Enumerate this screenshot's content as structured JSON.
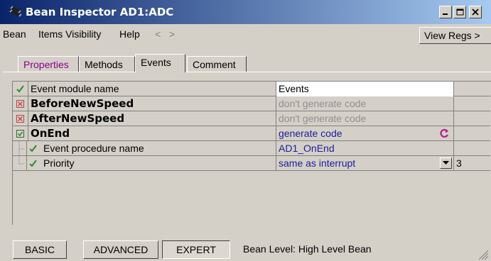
{
  "window": {
    "title": "Bean Inspector AD1:ADC",
    "icon": "bean-chip-icon",
    "controls": [
      "minimize-icon",
      "maximize-icon",
      "close-icon"
    ]
  },
  "menu": {
    "items": [
      "Bean",
      "Items Visibility",
      "Help"
    ],
    "back": "<",
    "forward": ">",
    "view_regs": "View Regs >"
  },
  "tabs": [
    {
      "label": "Properties",
      "active": false
    },
    {
      "label": "Methods",
      "active": false
    },
    {
      "label": "Events",
      "active": true
    },
    {
      "label": "Comment",
      "active": false
    }
  ],
  "rows": [
    {
      "check": "check",
      "name": "Event module name",
      "bold": false,
      "indent": 0,
      "value": "Events",
      "value_style": "white"
    },
    {
      "check": "disabled",
      "name": "BeforeNewSpeed",
      "bold": true,
      "indent": 0,
      "value": "don't generate code",
      "value_style": "gray"
    },
    {
      "check": "disabled",
      "name": "AfterNewSpeed",
      "bold": true,
      "indent": 0,
      "value": "don't generate code",
      "value_style": "gray"
    },
    {
      "check": "enabled",
      "name": "OnEnd",
      "bold": true,
      "indent": 0,
      "value": "generate code",
      "value_style": "blue"
    },
    {
      "check": "check",
      "name": "Event procedure name",
      "bold": false,
      "indent": 1,
      "value": "AD1_OnEnd",
      "value_style": "blue"
    },
    {
      "check": "check",
      "name": "Priority",
      "bold": false,
      "indent": 1,
      "value": "same as interrupt",
      "value_style": "blue",
      "extra": "3"
    }
  ],
  "status": {
    "buttons": [
      {
        "label": "BASIC",
        "pressed": false
      },
      {
        "label": "ADVANCED",
        "pressed": false
      },
      {
        "label": "EXPERT",
        "pressed": true
      }
    ],
    "level": "Bean Level: High Level Bean"
  },
  "colors": {
    "title_start": "#0a246a",
    "title_end": "#a6caf0",
    "check_green": "#2e8b2e",
    "disabled_red": "#c04040",
    "value_blue": "#1c1c9c",
    "value_gray": "#909090"
  }
}
